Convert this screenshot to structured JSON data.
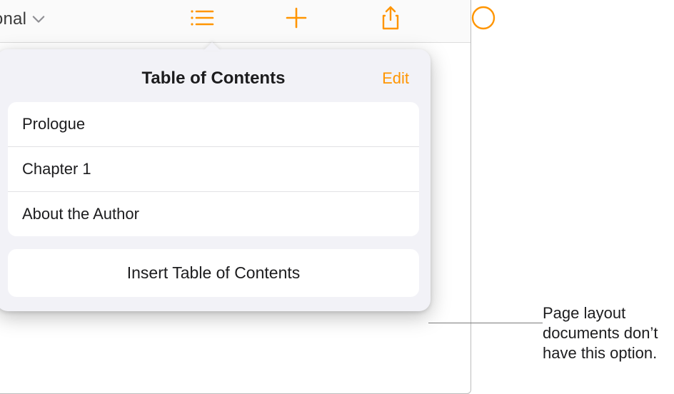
{
  "toolbar": {
    "doc_name_fragment": "ssional",
    "icons": {
      "list": "list-icon",
      "add": "plus-icon",
      "share": "share-icon",
      "collab": "collab-icon"
    }
  },
  "popover": {
    "title": "Table of Contents",
    "edit_label": "Edit",
    "items": [
      {
        "label": "Prologue"
      },
      {
        "label": "Chapter 1"
      },
      {
        "label": "About the Author"
      }
    ],
    "insert_label": "Insert Table of Contents"
  },
  "callout": {
    "text": "Page layout documents don’t have this option."
  },
  "colors": {
    "accent": "#ff9500"
  }
}
